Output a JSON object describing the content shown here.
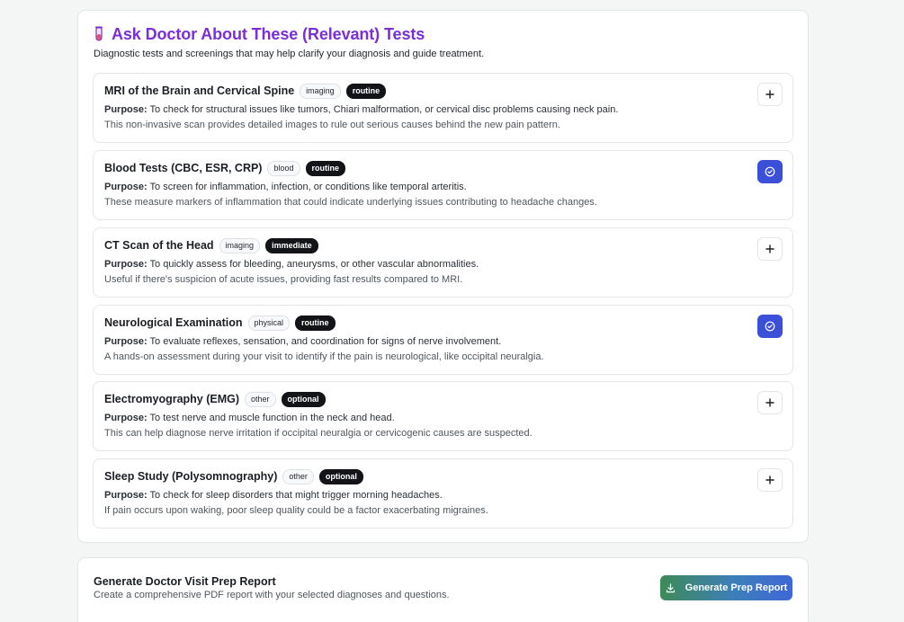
{
  "section": {
    "title": "Ask Doctor About These (Relevant) Tests",
    "subtitle": "Diagnostic tests and screenings that may help clarify your diagnosis and guide treatment.",
    "icon": "test-tube-icon",
    "title_color": "#7a2fd6"
  },
  "purpose_label": "Purpose:",
  "tests": [
    {
      "name": "MRI of the Brain and Cervical Spine",
      "category": "imaging",
      "priority": "routine",
      "purpose": "To check for structural issues like tumors, Chiari malformation, or cervical disc problems causing neck pain.",
      "description": "This non-invasive scan provides detailed images to rule out serious causes behind the new pain pattern.",
      "selected": false
    },
    {
      "name": "Blood Tests (CBC, ESR, CRP)",
      "category": "blood",
      "priority": "routine",
      "purpose": "To screen for inflammation, infection, or conditions like temporal arteritis.",
      "description": "These measure markers of inflammation that could indicate underlying issues contributing to headache changes.",
      "selected": true
    },
    {
      "name": "CT Scan of the Head",
      "category": "imaging",
      "priority": "immediate",
      "purpose": "To quickly assess for bleeding, aneurysms, or other vascular abnormalities.",
      "description": "Useful if there's suspicion of acute issues, providing fast results compared to MRI.",
      "selected": false
    },
    {
      "name": "Neurological Examination",
      "category": "physical",
      "priority": "routine",
      "purpose": "To evaluate reflexes, sensation, and coordination for signs of nerve involvement.",
      "description": "A hands-on assessment during your visit to identify if the pain is neurological, like occipital neuralgia.",
      "selected": true
    },
    {
      "name": "Electromyography (EMG)",
      "category": "other",
      "priority": "optional",
      "purpose": "To test nerve and muscle function in the neck and head.",
      "description": "This can help diagnose nerve irritation if occipital neuralgia or cervicogenic causes are suspected.",
      "selected": false
    },
    {
      "name": "Sleep Study (Polysomnography)",
      "category": "other",
      "priority": "optional",
      "purpose": "To check for sleep disorders that might trigger morning headaches.",
      "description": "If pain occurs upon waking, poor sleep quality could be a factor exacerbating migraines.",
      "selected": false
    }
  ],
  "footer": {
    "title": "Generate Doctor Visit Prep Report",
    "subtitle": "Create a comprehensive PDF report with your selected diagnoses and questions.",
    "button_label": "Generate Prep Report",
    "button_icon": "download-icon"
  },
  "colors": {
    "selected_button": "#3c4fd9",
    "priority_badge": "#121417",
    "generate_gradient_start": "#3f8a57",
    "generate_gradient_end": "#3f67d8"
  }
}
